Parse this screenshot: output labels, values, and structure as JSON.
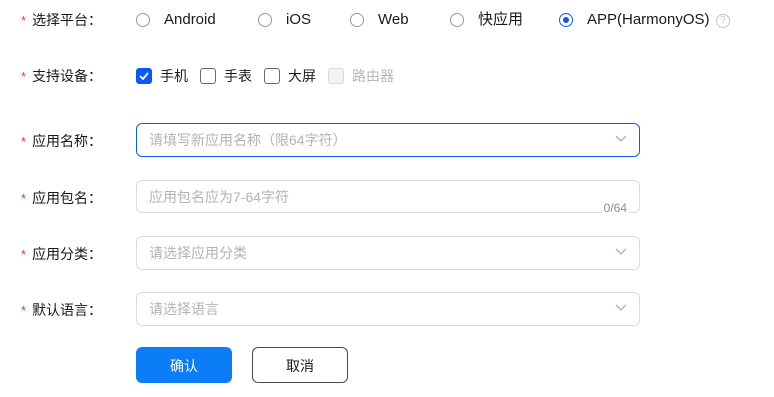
{
  "platform": {
    "label": "选择平台：",
    "options": [
      "Android",
      "iOS",
      "Web",
      "快应用",
      "APP(HarmonyOS)"
    ],
    "selected": "APP(HarmonyOS)",
    "help_glyph": "?"
  },
  "devices": {
    "label": "支持设备：",
    "options": [
      {
        "label": "手机",
        "checked": true,
        "disabled": false
      },
      {
        "label": "手表",
        "checked": false,
        "disabled": false
      },
      {
        "label": "大屏",
        "checked": false,
        "disabled": false
      },
      {
        "label": "路由器",
        "checked": false,
        "disabled": true
      }
    ]
  },
  "app_name": {
    "label": "应用名称：",
    "placeholder": "请填写新应用名称（限64字符）",
    "value": ""
  },
  "package_name": {
    "label": "应用包名：",
    "placeholder": "应用包名应为7-64字符",
    "value": "",
    "counter": "0/64"
  },
  "category": {
    "label": "应用分类：",
    "placeholder": "请选择应用分类",
    "value": ""
  },
  "language": {
    "label": "默认语言：",
    "placeholder": "请选择语言",
    "value": ""
  },
  "required_mark": "*",
  "actions": {
    "confirm": "确认",
    "cancel": "取消"
  },
  "colors": {
    "accent": "#0a59f7",
    "primary_button": "#0a7df7",
    "required": "#e84026"
  }
}
